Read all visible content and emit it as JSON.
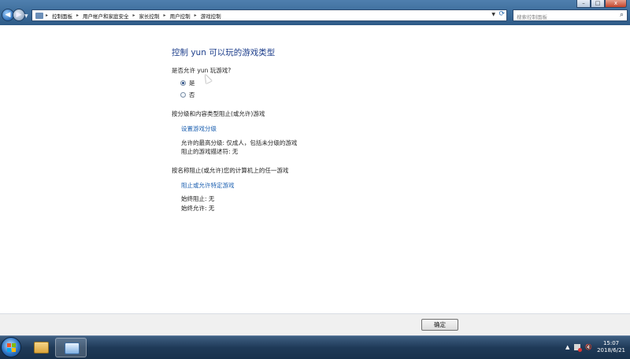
{
  "window": {
    "minimize": "–",
    "maximize": "□",
    "close": "x"
  },
  "nav": {
    "back_icon": "back-arrow-icon",
    "forward_icon": "forward-arrow-icon"
  },
  "address": {
    "breadcrumb": [
      "控制面板",
      "用户帐户和家庭安全",
      "家长控制",
      "用户控制",
      "游戏控制"
    ]
  },
  "search": {
    "placeholder": "搜索控制面板"
  },
  "main": {
    "title": "控制 yun 可以玩的游戏类型",
    "question": "是否允许 yun 玩游戏?",
    "options": [
      {
        "label": "是",
        "selected": true
      },
      {
        "label": "否",
        "selected": false
      }
    ],
    "section_rating": {
      "heading": "按分级和内容类型阻止(或允许)游戏",
      "link": "设置游戏分级",
      "max_rating": "允许的最高分级: 仅成人，包括未分级的游戏",
      "blocked_descriptors": "阻止的游戏描述符: 无"
    },
    "section_name": {
      "heading": "按名称阻止(或允许)您的计算机上的任一游戏",
      "link": "阻止或允许特定游戏",
      "always_block": "始终阻止: 无",
      "always_allow": "始终允许: 无"
    }
  },
  "footer": {
    "ok_label": "确定"
  },
  "taskbar": {
    "tray_arrow": "▲",
    "time": "15:07",
    "date": "2018/6/21"
  },
  "colors": {
    "title_blue": "#1e3f8c",
    "link_blue": "#1b5fb0",
    "taskbar": "#1f3a58"
  }
}
